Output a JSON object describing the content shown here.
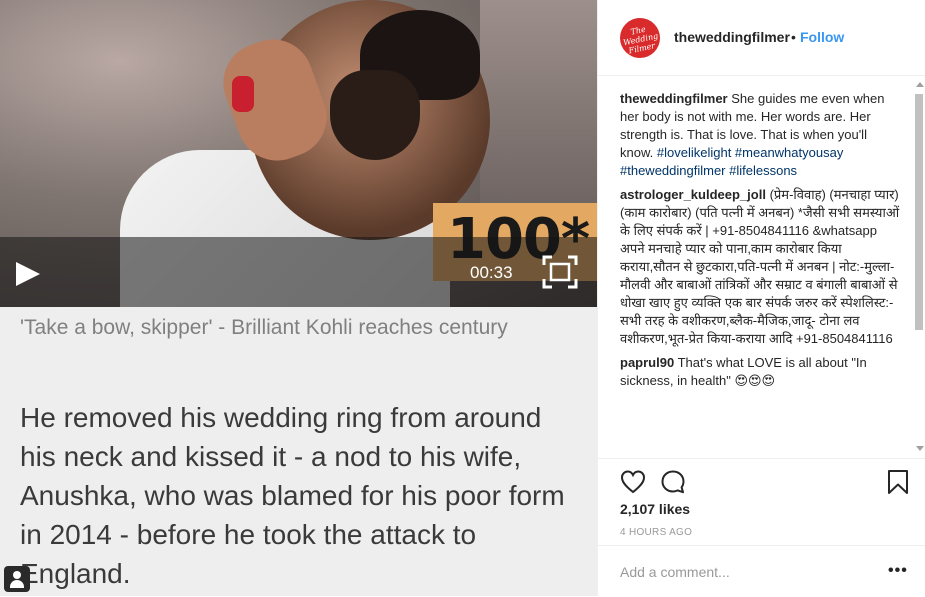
{
  "video": {
    "score": "100*",
    "time": "00:33",
    "caption": "'Take a bow, skipper' - Brilliant Kohli reaches century",
    "quote": "He removed his wedding ring from around his neck and kissed it - a nod to his wife, Anushka, who was blamed for his poor form in 2014 - before he took the attack to England.",
    "icons": [
      "play-icon",
      "fullscreen-icon",
      "user-icon"
    ]
  },
  "post": {
    "handle": "theweddingfilmer",
    "avatar_text": "The Wedding Filmer",
    "separator": "•",
    "follow_label": "Follow",
    "accent_color": "#3897f0",
    "avatar_color": "#d92b2b"
  },
  "comments": [
    {
      "user": "theweddingfilmer",
      "text": "She guides me even when her body is not with me. Her words are. Her strength is. That is love. That is when you'll know.",
      "tags": "#lovelikelight #meanwhatyousay #theweddingfilmer #lifelessons"
    },
    {
      "user": "astrologer_kuldeep_joll",
      "text": "(प्रेम-विवाह) (मनचाहा प्यार) (काम कारोबार) (पति पत्नी में अनबन) *जैसी सभी समस्याओं के लिए संपर्क करें | +91-8504841116 &whatsapp अपने मनचाहे प्यार को पाना,काम कारोबार किया कराया,सौतन से छुटकारा,पति-पत्नी में अनबन | नोट:-मुल्ला-मौलवी और बाबाओं तांत्रिकों और सम्राट व बंगाली बाबाओं से धोखा खाए हुए व्यक्ति एक बार संपर्क जरुर करें स्पेशलिस्ट:-सभी तरह के वशीकरण,ब्लैक-मैजिक,जादू- टोना लव वशीकरण,भूत-प्रेत किया-कराया आदि +91-8504841116"
    },
    {
      "user": "paprul90",
      "text": "That's what LOVE is all about \"In sickness, in health\" 😍😍😍"
    }
  ],
  "actions": {
    "likes": "2,107 likes",
    "time": "4 HOURS AGO",
    "add_comment_placeholder": "Add a comment...",
    "more": "•••",
    "icons": [
      "heart-icon",
      "comment-icon",
      "bookmark-icon"
    ]
  }
}
